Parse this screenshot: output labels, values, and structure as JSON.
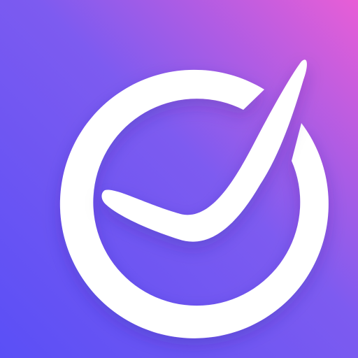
{
  "app_icon": {
    "icon_name": "circle-check-mark-icon",
    "colors": {
      "background_gradient_start": "#5A4FF6",
      "background_gradient_mid": "#7D5BF0",
      "background_gradient_end": "#E85ED6",
      "foreground": "#FFFFFF"
    }
  }
}
